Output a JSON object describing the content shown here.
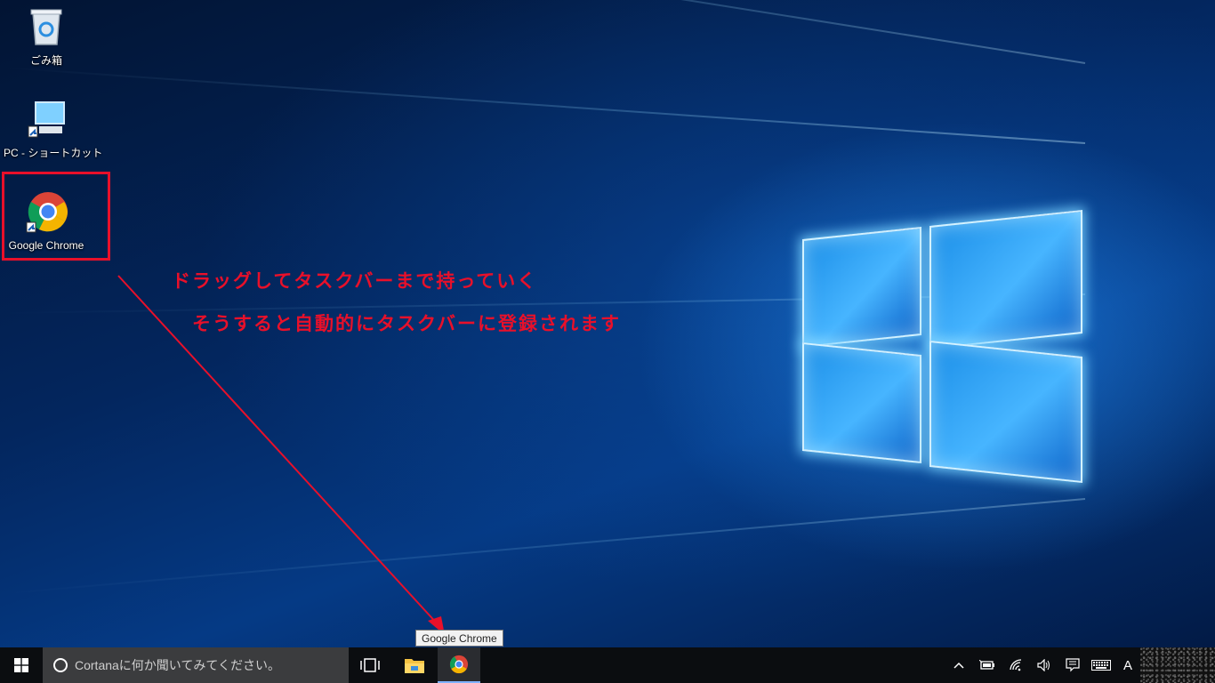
{
  "desktop": {
    "icons": [
      {
        "label": "ごみ箱",
        "icon": "recycle-bin-icon"
      },
      {
        "label": "PC - ショートカット",
        "icon": "pc-icon"
      },
      {
        "label": "Google Chrome",
        "icon": "chrome-icon"
      }
    ]
  },
  "annotation": {
    "line1": "ドラッグしてタスクバーまで持っていく",
    "line2": "そうすると自動的にタスクバーに登録されます",
    "color": "#e8102a"
  },
  "tooltip": {
    "text": "Google Chrome"
  },
  "taskbar": {
    "search_placeholder": "Cortanaに何か聞いてみてください。",
    "apps": [
      {
        "name": "Task View",
        "icon": "task-view-icon"
      },
      {
        "name": "File Explorer",
        "icon": "folder-icon"
      },
      {
        "name": "Google Chrome",
        "icon": "chrome-icon"
      }
    ],
    "tray": {
      "ime": "A"
    }
  }
}
